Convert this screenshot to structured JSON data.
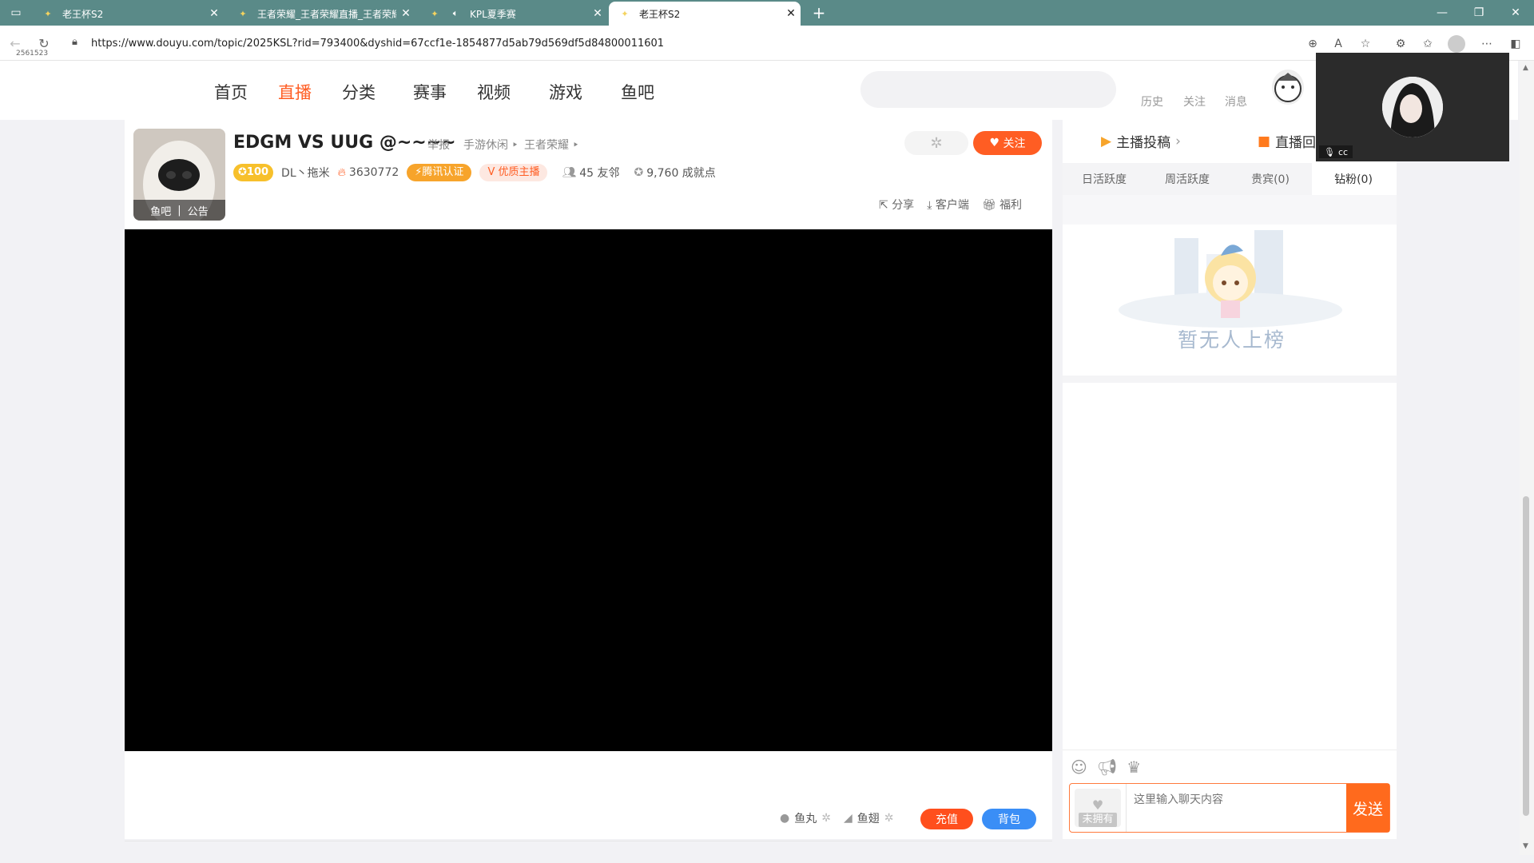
{
  "browser": {
    "tabs": [
      {
        "title": "老王杯S2",
        "active": false
      },
      {
        "title": "王者荣耀_王者荣耀直播_王者荣耀",
        "active": false
      },
      {
        "title": "KPL夏季赛",
        "active": false,
        "muted_icon": "speaker-icon"
      },
      {
        "title": "老王杯S2",
        "active": true
      }
    ],
    "new_tab": "+",
    "url": "https://www.douyu.com/topic/2025KSL?rid=793400&dyshid=67ccf1e-1854877d5ab79d569df5d84800011601",
    "corner_id": "2561523"
  },
  "site": {
    "nav": [
      "首页",
      "直播",
      "分类",
      "赛事",
      "视频",
      "游戏",
      "鱼吧"
    ],
    "active_nav": "直播",
    "header_links": [
      "历史",
      "关注",
      "消息"
    ]
  },
  "room": {
    "title": "EDGM VS UUG @~~~~",
    "report": "举报",
    "category1": "手游休闲",
    "category2": "王者荣耀",
    "level": "100",
    "anchor": "DL丶拖米",
    "heat": "3630772",
    "cert": "腾讯认证",
    "quality": "优质主播",
    "friends": "45 友邻",
    "achievement": "9,760 成就点",
    "avatar_links": [
      "鱼吧",
      "公告"
    ],
    "follow": "关注",
    "actions": [
      "分享",
      "客户端",
      "福利"
    ]
  },
  "player_bar": {
    "fishball": "鱼丸",
    "fishwing": "鱼翅",
    "recharge": "充值",
    "bag": "背包"
  },
  "side": {
    "top_tabs": [
      "主播投稿",
      "直播回"
    ],
    "rank_tabs": [
      "日活跃度",
      "周活跃度",
      "贵宾(0)",
      "钻粉(0)"
    ],
    "empty_text": "暂无人上榜",
    "chat_placeholder": "这里输入聊天内容",
    "no_badge": "未拥有",
    "send": "发送"
  },
  "pip": {
    "label": "cc"
  },
  "colors": {
    "accent": "#ff5d23",
    "tabbar": "#5a8a88",
    "blue": "#3a8ef6"
  }
}
